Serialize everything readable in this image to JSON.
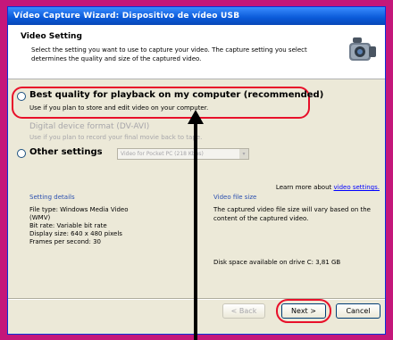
{
  "window": {
    "title": "Vídeo Capture Wizard: Dispositivo de vídeo USB"
  },
  "header": {
    "title": "Video Setting",
    "description": "Select the setting you want to use to capture your video. The capture setting you select determines the quality and size of the captured video."
  },
  "options": {
    "best": {
      "label": "Best quality for playback on my computer (recommended)",
      "sub": "Use if you plan to store and edit video on your computer.",
      "selected": false
    },
    "dv": {
      "label": "Digital device format (DV-AVI)",
      "sub": "Use if you plan to record your final movie back to tape."
    },
    "other": {
      "label": "Other settings",
      "combo_value": "Video for Pocket PC (218 Kbps)"
    }
  },
  "learn_more": {
    "text": "Learn more about",
    "link": "video settings."
  },
  "setting_details": {
    "title": "Setting details",
    "lines": [
      "File type: Windows Media Video",
      "(WMV)",
      "Bit rate: Variable bit rate",
      "Display size: 640 x 480 pixels",
      "Frames per second: 30"
    ]
  },
  "video_file_size": {
    "title": "Video file size",
    "text": "The captured video file size will vary based on the content of the captured video.",
    "disk_space": "Disk space available on drive C: 3,81 GB"
  },
  "buttons": {
    "back": "< Back",
    "next": "Next >",
    "cancel": "Cancel"
  },
  "colors": {
    "annotation": "#e8102a",
    "frame": "#c4177a",
    "titlebar": "#0a5ad8"
  },
  "icons": {
    "camera": "camera-icon",
    "arrow": "up-arrow-icon"
  }
}
